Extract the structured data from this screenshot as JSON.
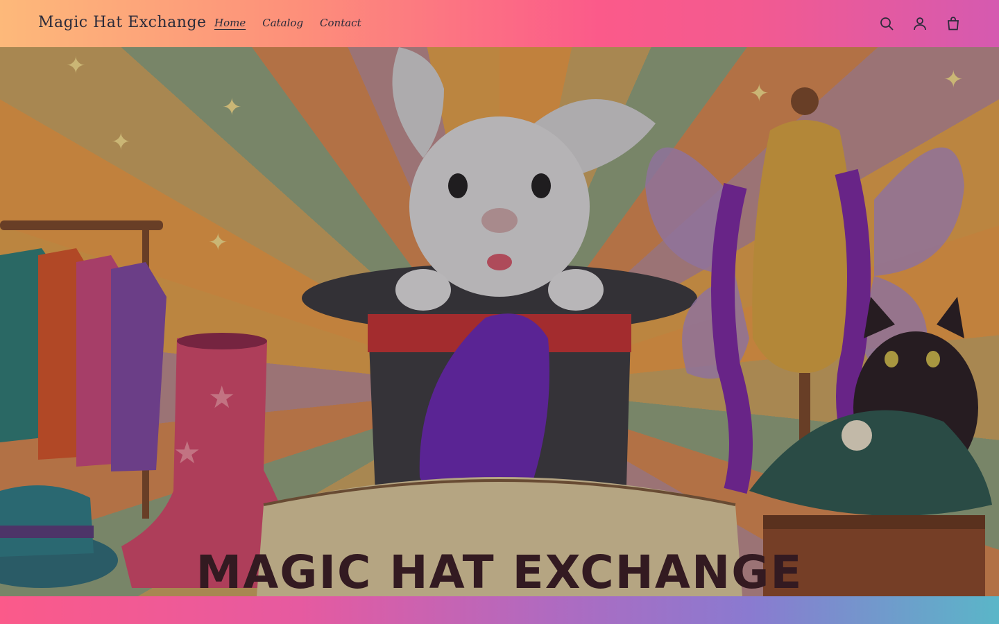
{
  "header": {
    "brand": "Magic Hat Exchange",
    "nav": [
      {
        "label": "Home",
        "active": true
      },
      {
        "label": "Catalog",
        "active": false
      },
      {
        "label": "Contact",
        "active": false
      }
    ],
    "icons": [
      "search-icon",
      "account-icon",
      "cart-icon"
    ]
  },
  "hero": {
    "banner_text": "MAGIC HAT EXCHANGE"
  },
  "colors": {
    "text": "#2b2b3a",
    "header_start": "#fdb97a",
    "header_end": "#d55ab0"
  }
}
